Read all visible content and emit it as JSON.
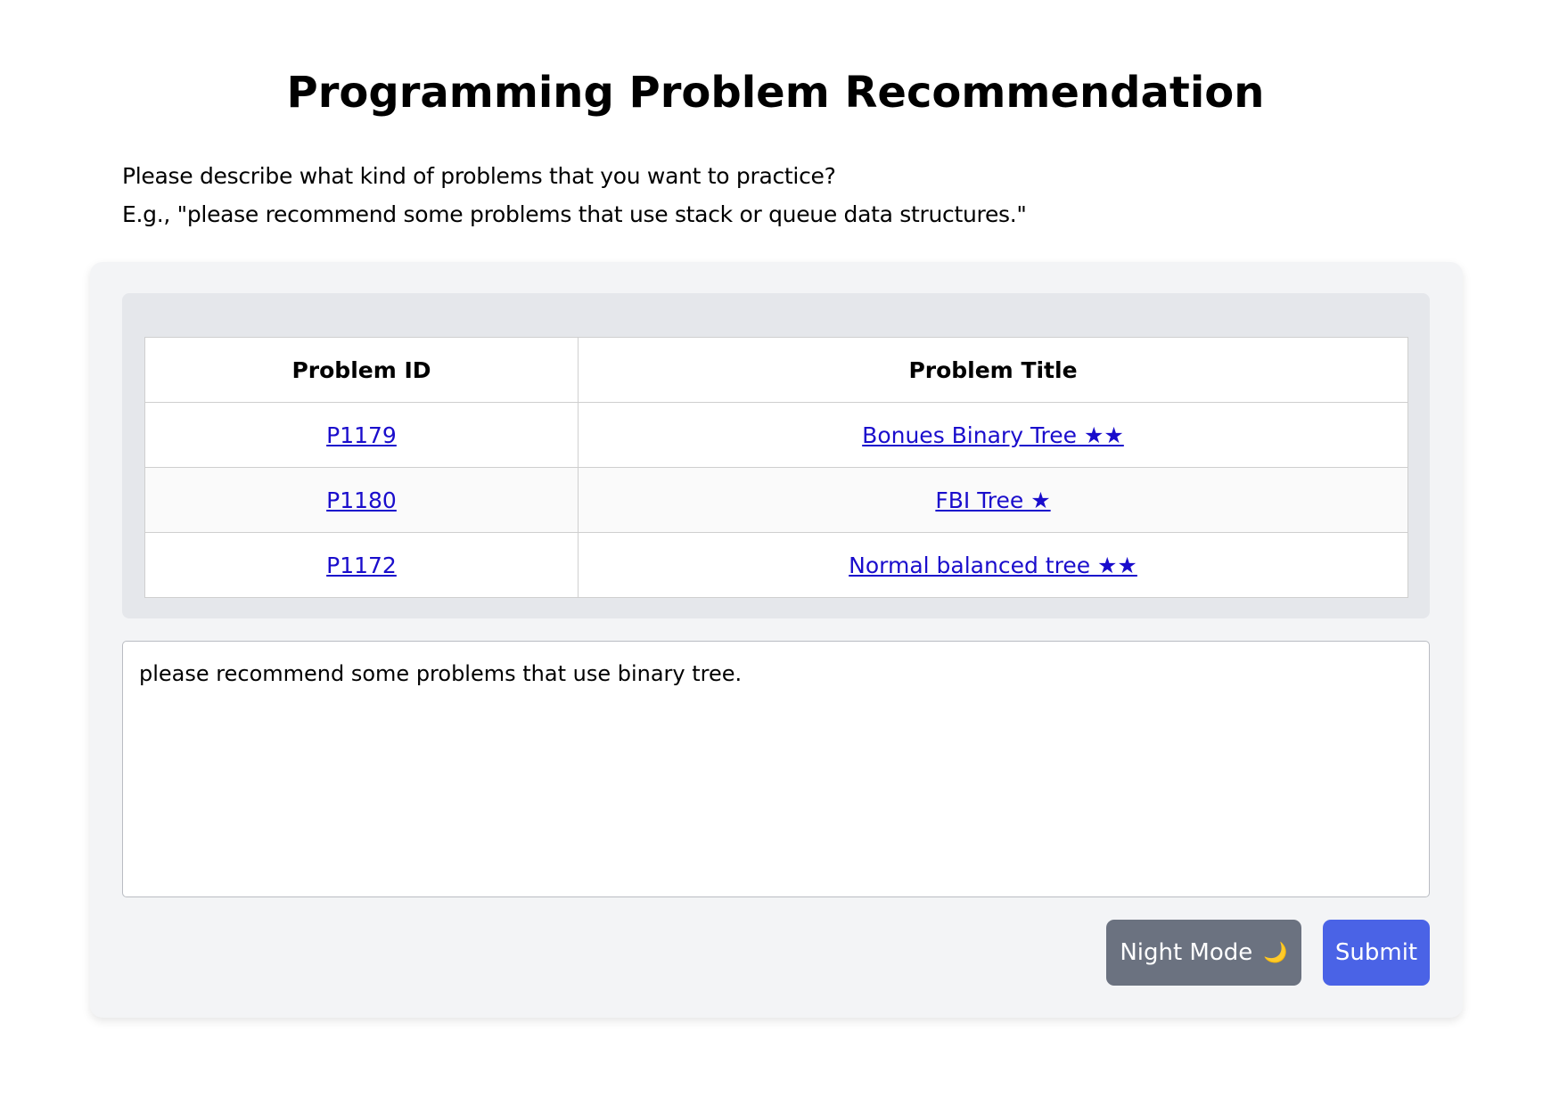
{
  "page": {
    "title": "Programming Problem Recommendation"
  },
  "intro": {
    "line1": "Please describe what kind of problems that you want to practice?",
    "line2": "E.g., \"please recommend some problems that use stack or queue data structures.\""
  },
  "results": {
    "headers": [
      "Problem ID",
      "Problem Title"
    ],
    "rows": [
      {
        "id": "P1179",
        "title": "Bonues Binary Tree ★★"
      },
      {
        "id": "P1180",
        "title": "FBI Tree ★"
      },
      {
        "id": "P1172",
        "title": "Normal balanced tree ★★"
      }
    ]
  },
  "query": {
    "value": "please recommend some problems that use binary tree."
  },
  "buttons": {
    "night_mode_label": "Night Mode",
    "night_mode_icon": "moon-icon",
    "submit_label": "Submit"
  },
  "colors": {
    "card_bg": "#f3f4f6",
    "panel_bg": "#e5e7eb",
    "link": "#1a0dcc",
    "night_button": "#6b7280",
    "submit_button": "#4a63e6"
  }
}
